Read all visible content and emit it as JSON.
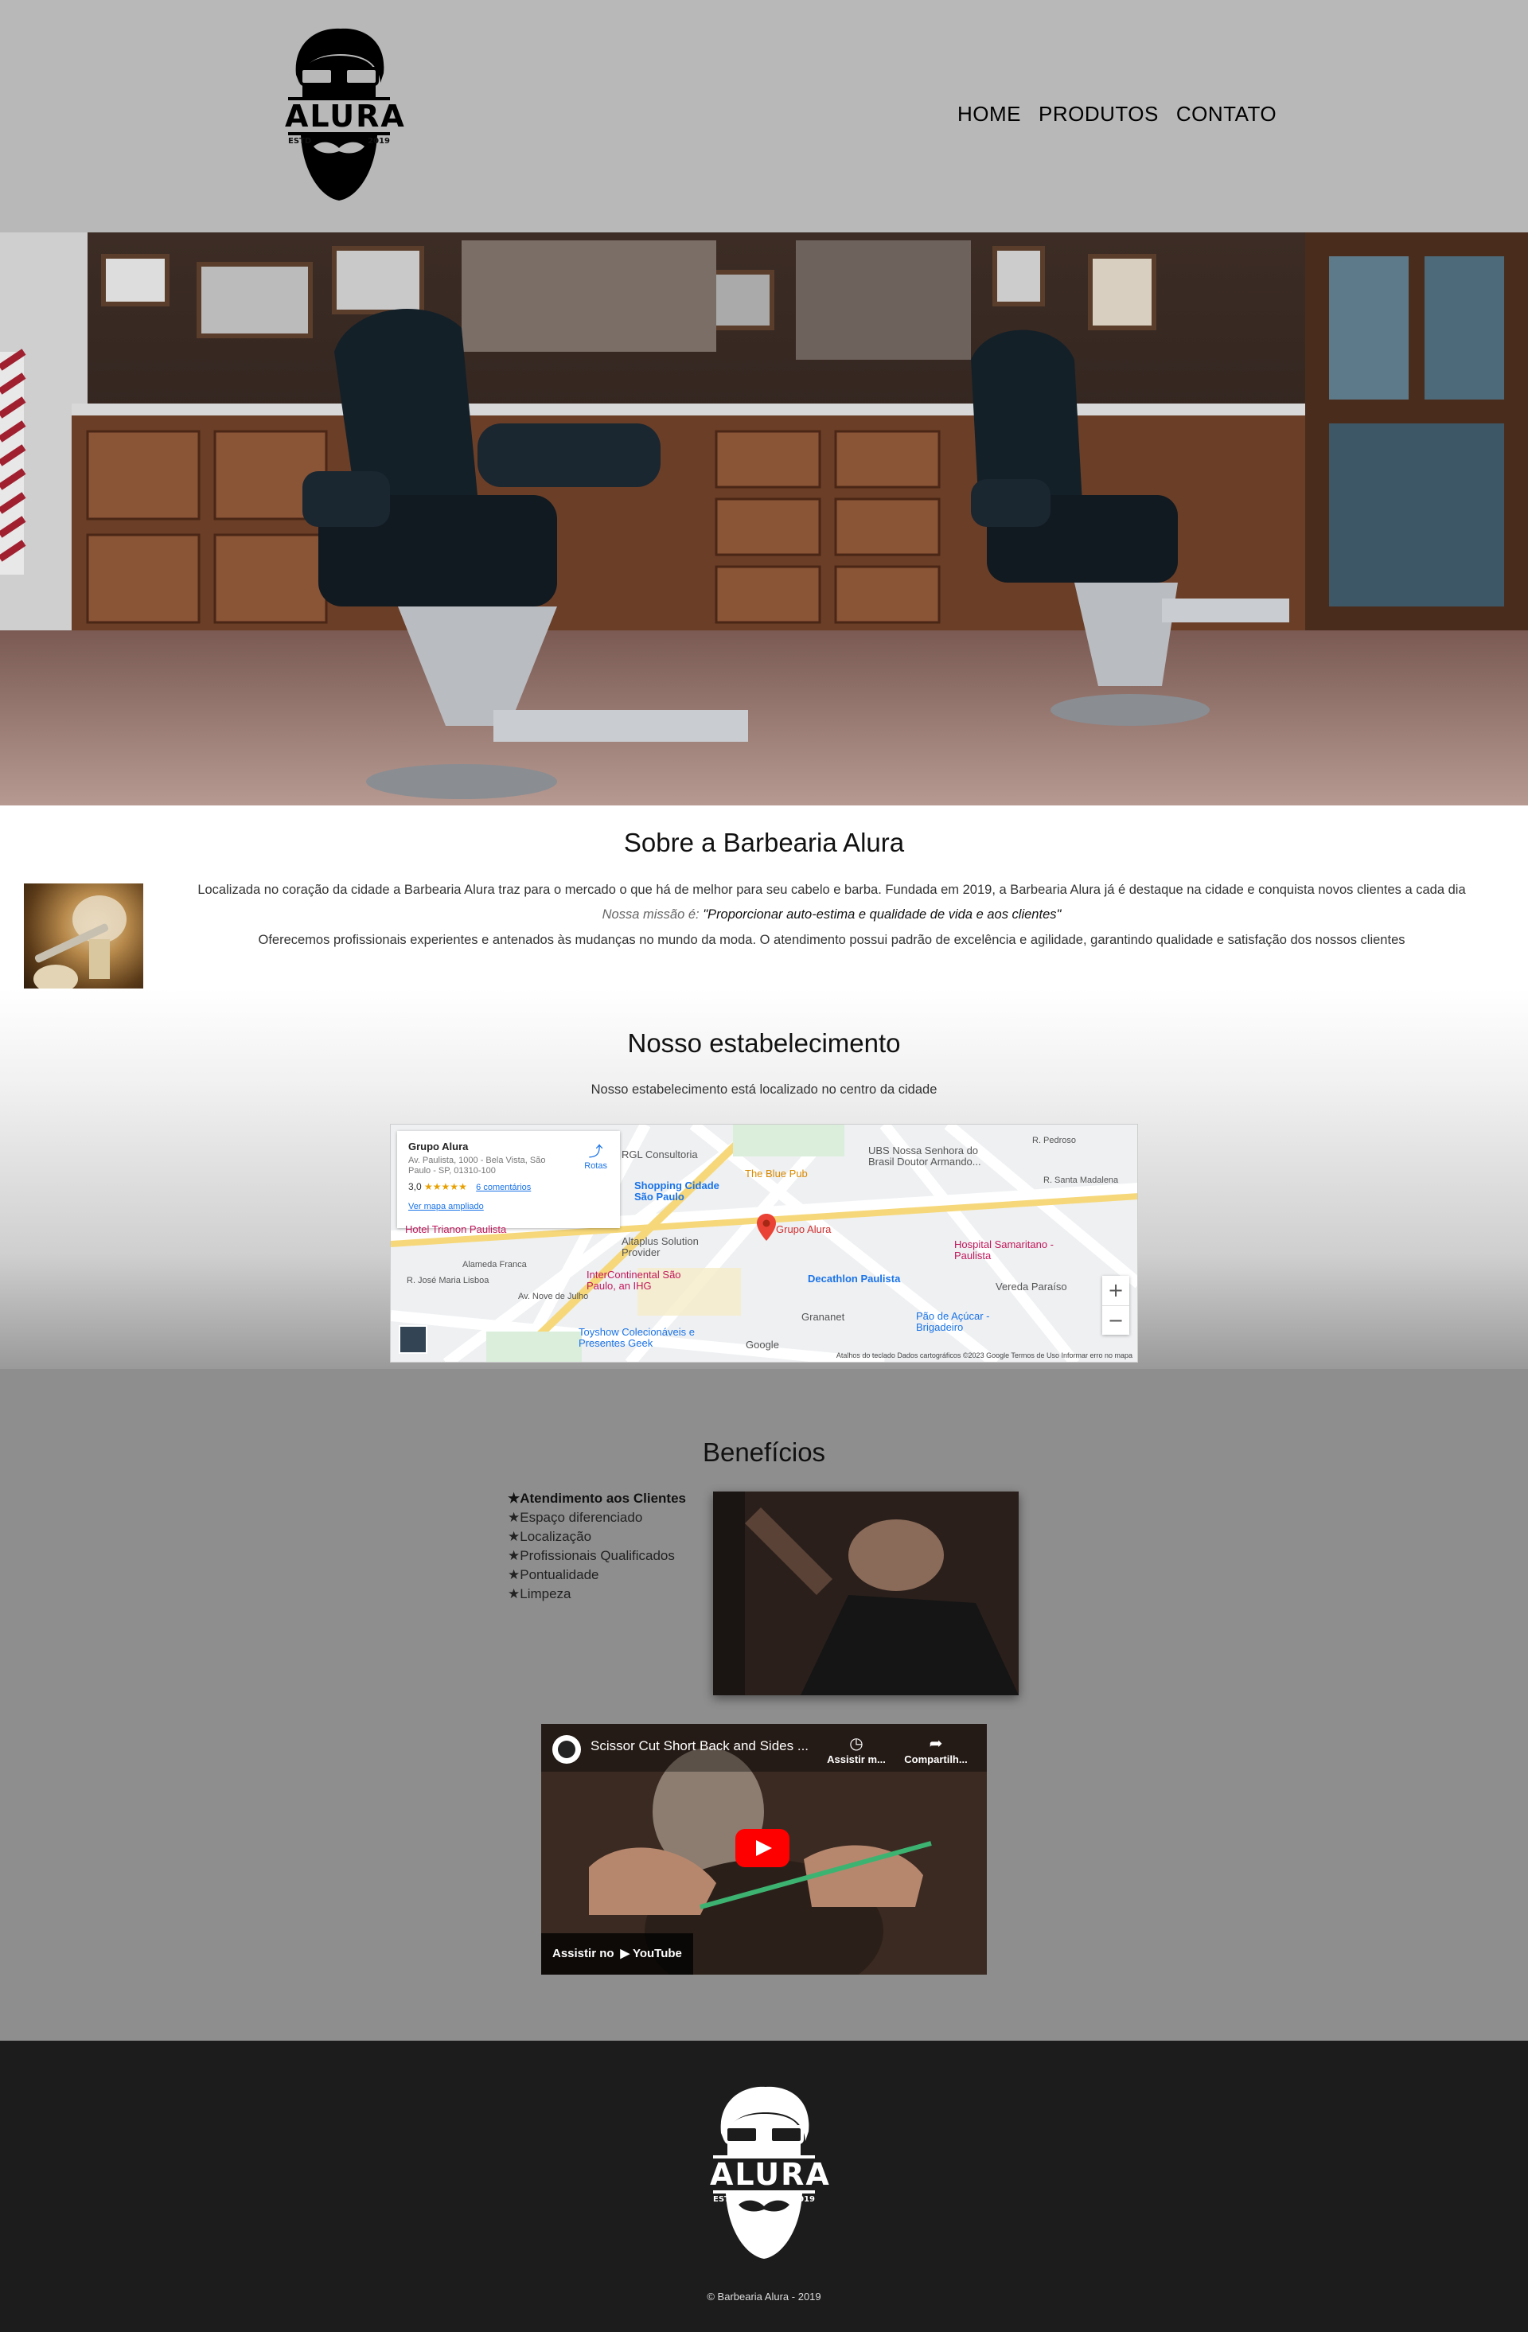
{
  "header": {
    "logo_text": "ALURA",
    "logo_est": "ESTD",
    "logo_year": "2019",
    "nav": [
      "HOME",
      "PRODUTOS",
      "CONTATO"
    ]
  },
  "about": {
    "title": "Sobre a Barbearia Alura",
    "paragraph1": "Localizada no coração da cidade a Barbearia Alura traz para o mercado o que há de melhor para seu cabelo e barba. Fundada em 2019, a Barbearia Alura já é destaque na cidade e conquista novos clientes a cada dia",
    "mission_label": "Nossa missão é:",
    "mission_quote": "\"Proporcionar auto-estima e qualidade de vida e aos clientes\"",
    "paragraph2": "Oferecemos profissionais experientes e antenados às mudanças no mundo da moda. O atendimento possui padrão de excelência e agilidade, garantindo qualidade e satisfação dos nossos clientes"
  },
  "establishment": {
    "title": "Nosso estabelecimento",
    "subtitle": "Nosso estabelecimento está localizado no centro da cidade",
    "map": {
      "place_name": "Grupo Alura",
      "address": "Av. Paulista, 1000 - Bela Vista, São Paulo - SP, 01310-100",
      "rating": "3,0",
      "stars": "★★★★★",
      "reviews": "6 comentários",
      "larger_map": "Ver mapa ampliado",
      "routes": "Rotas",
      "labels": [
        "RGL Consultoria",
        "The Blue Pub",
        "UBS Nossa Senhora do Brasil Doutor Armando...",
        "Shopping Cidade São Paulo",
        "Hotel Trianon Paulista",
        "Grupo Alura",
        "Altaplus Solution Provider",
        "Hospital Samaritano - Paulista",
        "InterContinental São Paulo, an IHG",
        "Decathlon Paulista",
        "Vereda Paraíso",
        "Grananet",
        "Pão de Açúcar - Brigadeiro",
        "Toyshow Colecionáveis e Presentes Geek",
        "R. Pedroso",
        "R. Santa Madalena",
        "Alameda Franca",
        "Av. Nove de Julho",
        "R. José Maria Lisboa"
      ],
      "zoom_in": "+",
      "zoom_out": "−",
      "google": "Google",
      "footer": "Atalhos do teclado   Dados cartográficos ©2023 Google   Termos de Uso   Informar erro no mapa"
    }
  },
  "benefits": {
    "title": "Benefícios",
    "items": [
      "★Atendimento aos Clientes",
      "★Espaço diferenciado",
      "★Localização",
      "★Profissionais Qualificados",
      "★Pontualidade",
      "★Limpeza"
    ],
    "video": {
      "title": "Scissor Cut Short Back and Sides ...",
      "watch_later": "Assistir m...",
      "share": "Compartilh...",
      "watch_on": "Assistir no",
      "youtube": "▶ YouTube"
    }
  },
  "footer": {
    "logo_text": "ALURA",
    "logo_est": "ESTD",
    "logo_year": "2019",
    "copyright": "© Barbearia Alura - 2019"
  },
  "colors": {
    "header_bg": "#b8b8b8",
    "benefits_bg": "#8e8e8e",
    "footer_bg": "#1c1c1c",
    "youtube_red": "#ff0000",
    "map_link": "#1a73e8"
  }
}
